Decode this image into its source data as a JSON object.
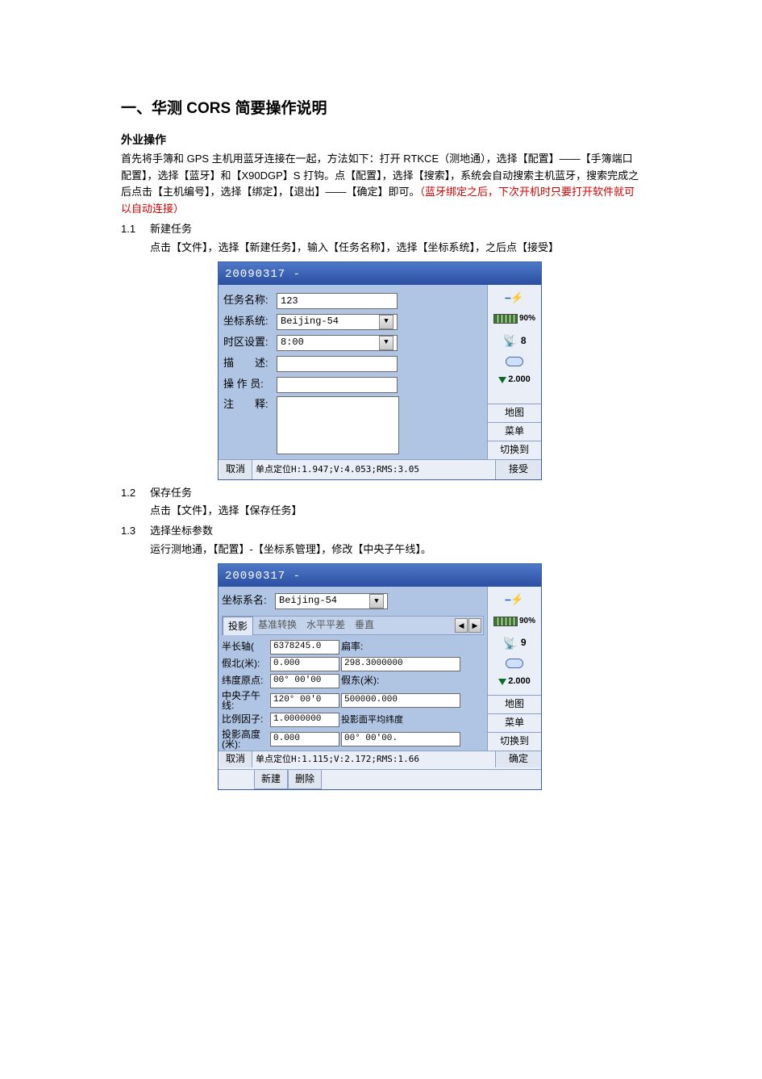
{
  "doc": {
    "title": "一、华测 CORS 简要操作说明",
    "subhead": "外业操作",
    "p1": "首先将手簿和 GPS 主机用蓝牙连接在一起，方法如下：打开 RTKCE（测地通），选择【配置】——【手簿端口配置】，选择【蓝牙】和【X90DGP】S 打钩。点【配置】，选择【搜索】，系统会自动搜索主机蓝牙，搜索完成之后点击【主机编号】，选择【绑定】，【退出】——【确定】即可。",
    "p1_red": "（蓝牙绑定之后，下次开机时只要打开软件就可以自动连接）",
    "sec11_num": "1.1",
    "sec11_title": "新建任务",
    "sec11_body": "点击【文件】，选择【新建任务】，输入【任务名称】，选择【坐标系统】，之后点【接受】",
    "sec12_num": "1.2",
    "sec12_title": "保存任务",
    "sec12_body": "点击【文件】，选择【保存任务】",
    "sec13_num": "1.3",
    "sec13_title": "选择坐标参数",
    "sec13_body": "运行测地通，【配置】-【坐标系管理】，修改【中央子午线】。"
  },
  "screen1": {
    "titlebar": "20090317 -",
    "labels": {
      "task_name": "任务名称:",
      "coord_sys": "坐标系统:",
      "timezone": "时区设置:",
      "desc": "描　　述:",
      "operator": "操 作 员:",
      "notes": "注　　释:"
    },
    "values": {
      "task_name": "123",
      "coord_sys": "Beijing-54",
      "timezone": "8:00",
      "desc": "",
      "operator": "",
      "notes": ""
    },
    "side": {
      "battery": "90%",
      "sat": "8",
      "height": "2.000",
      "btn_map": "地图",
      "btn_menu": "菜单",
      "btn_switch": "切换到"
    },
    "footer": {
      "cancel": "取消",
      "status": "单点定位H:1.947;V:4.053;RMS:3.05",
      "accept": "接受"
    }
  },
  "screen2": {
    "titlebar": "20090317 -",
    "coord_name_label": "坐标系名:",
    "coord_name_value": "Beijing-54",
    "tabs": [
      "投影",
      "基准转换",
      "水平平差",
      "垂直"
    ],
    "fields": {
      "semi_major_lbl": "半长轴(",
      "semi_major": "6378245.0",
      "flat_lbl": "扁率:",
      "flat": "298.3000000",
      "false_n_lbl": "假北(米):",
      "false_n": "0.000",
      "false_e_lbl": "假东(米):",
      "false_e": "500000.000",
      "lat_origin_lbl": "纬度原点:",
      "lat_origin": "00° 00'00",
      "central_lbl": "中央子午线:",
      "central": "120° 00'0",
      "avg_lat_lbl": "投影面平均纬度",
      "avg_lat": "00° 00'00.",
      "scale_lbl": "比例因子:",
      "scale": "1.0000000",
      "proj_h_lbl": "投影高度(米):",
      "proj_h": "0.000"
    },
    "side": {
      "battery": "90%",
      "sat": "9",
      "height": "2.000",
      "btn_map": "地图",
      "btn_menu": "菜单",
      "btn_switch": "切换到"
    },
    "footer": {
      "cancel": "取消",
      "status": "单点定位H:1.115;V:2.172;RMS:1.66",
      "new": "新建",
      "delete": "删除",
      "accept": "确定"
    }
  }
}
